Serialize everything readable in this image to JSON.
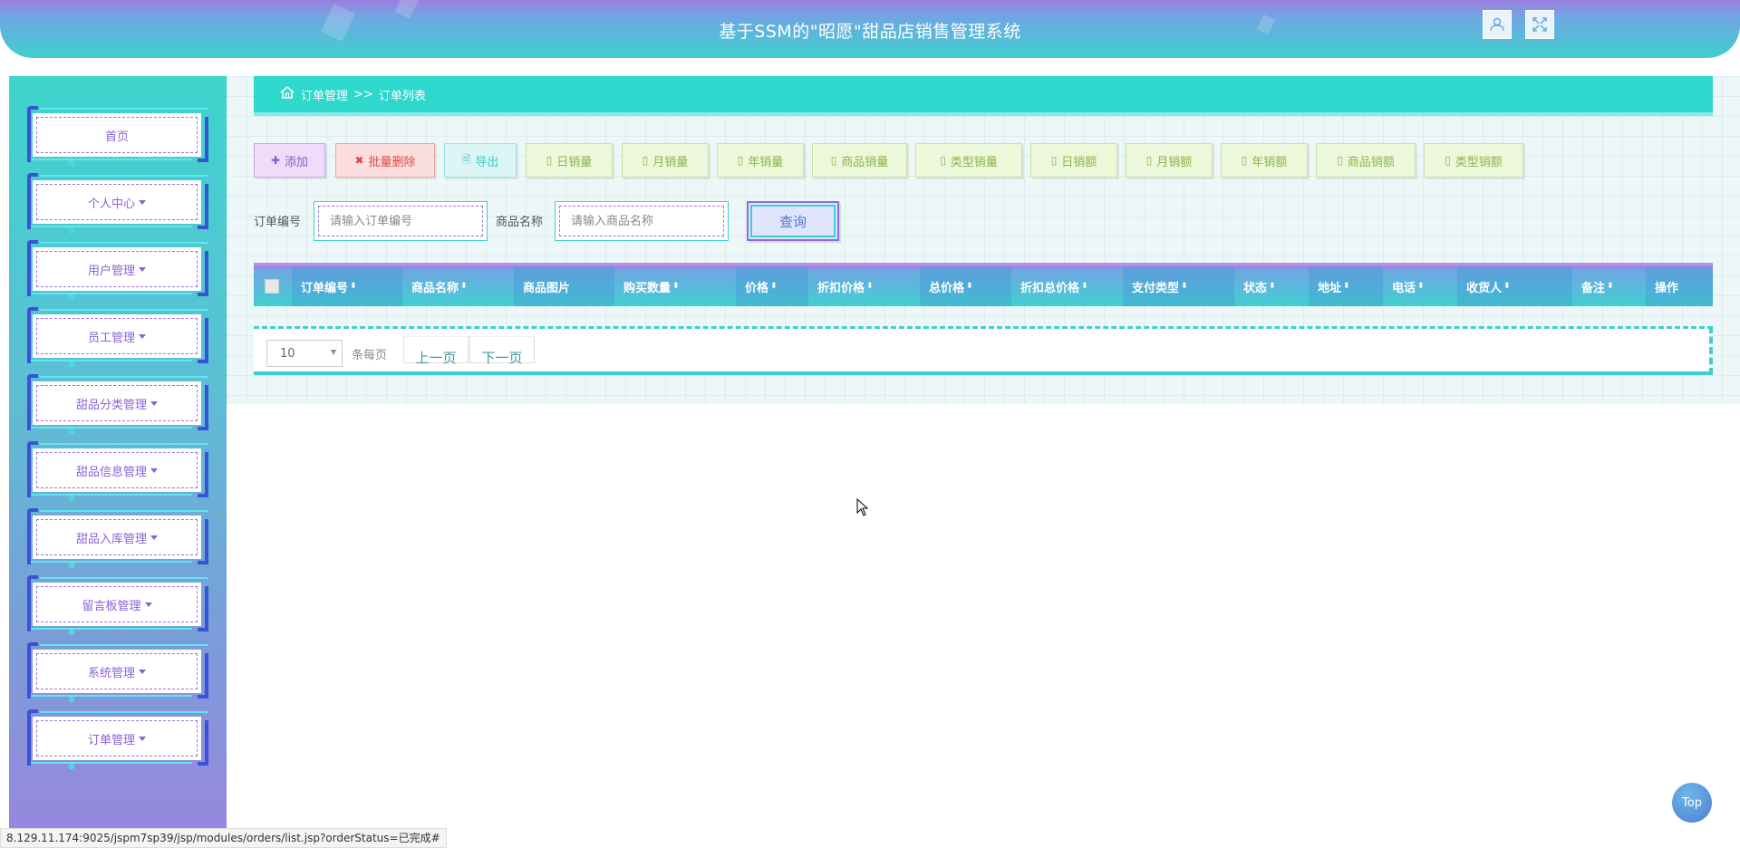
{
  "header": {
    "title": "基于SSM的\"昭愿\"甜品店销售管理系统"
  },
  "sidebar": {
    "items": [
      {
        "label": "首页",
        "has_caret": false
      },
      {
        "label": "个人中心",
        "has_caret": true
      },
      {
        "label": "用户管理",
        "has_caret": true
      },
      {
        "label": "员工管理",
        "has_caret": true
      },
      {
        "label": "甜品分类管理",
        "has_caret": true
      },
      {
        "label": "甜品信息管理",
        "has_caret": true
      },
      {
        "label": "甜品入库管理",
        "has_caret": true
      },
      {
        "label": "留言板管理",
        "has_caret": true
      },
      {
        "label": "系统管理",
        "has_caret": true
      },
      {
        "label": "订单管理",
        "has_caret": true
      }
    ]
  },
  "breadcrumb": {
    "section": "订单管理",
    "separator": ">>",
    "page": "订单列表"
  },
  "toolbar": {
    "add": "添加",
    "batch_delete": "批量删除",
    "export": "导出",
    "stats": [
      "日销量",
      "月销量",
      "年销量",
      "商品销量",
      "类型销量",
      "日销额",
      "月销额",
      "年销额",
      "商品销额",
      "类型销额"
    ]
  },
  "search": {
    "order_no_label": "订单编号",
    "order_no_placeholder": "请输入订单编号",
    "product_name_label": "商品名称",
    "product_name_placeholder": "请输入商品名称",
    "query_button": "查询"
  },
  "table": {
    "columns": [
      "订单编号",
      "商品名称",
      "商品图片",
      "购买数量",
      "价格",
      "折扣价格",
      "总价格",
      "折扣总价格",
      "支付类型",
      "状态",
      "地址",
      "电话",
      "收货人",
      "备注",
      "操作"
    ],
    "sortable": [
      true,
      true,
      false,
      true,
      true,
      true,
      true,
      true,
      true,
      true,
      true,
      true,
      true,
      true,
      false
    ]
  },
  "pager": {
    "page_size": "10",
    "per_page_label": "条每页",
    "prev": "上一页",
    "next": "下一页"
  },
  "status_url": "8.129.11.174:9025/jspm7sp39/jsp/modules/orders/list.jsp?orderStatus=已完成#",
  "top_button": "Top",
  "colors": {
    "accent_teal": "#2ed8cc",
    "accent_purple": "#8a62d6",
    "sidebar_frame": "#3a52d8"
  }
}
